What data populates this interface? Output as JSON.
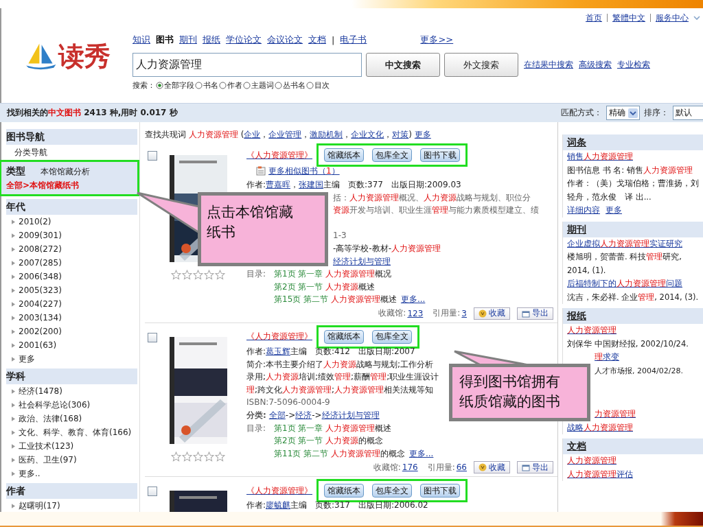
{
  "header": {
    "top_links": [
      "首页",
      "繁體中文",
      "服务中心"
    ],
    "logo": "读秀",
    "nav": [
      {
        "label": "知识",
        "kind": "tab",
        "selected": false
      },
      {
        "label": "图书",
        "kind": "tab",
        "selected": true
      },
      {
        "label": "期刊",
        "kind": "tab",
        "selected": false
      },
      {
        "label": "报纸",
        "kind": "tab",
        "selected": false
      },
      {
        "label": "学位论文",
        "kind": "tab",
        "selected": false
      },
      {
        "label": "会议论文",
        "kind": "tab",
        "selected": false
      },
      {
        "label": "文档",
        "kind": "tab",
        "selected": false
      },
      {
        "label": "|",
        "kind": "separator"
      },
      {
        "label": "电子书",
        "kind": "tab",
        "selected": false
      }
    ],
    "more": "更多>>",
    "search": {
      "value": "人力资源管理"
    },
    "buttons": [
      {
        "label": "中文搜索",
        "primary": true
      },
      {
        "label": "外文搜索",
        "primary": false
      }
    ],
    "links": [
      "在结果中搜索",
      "高级搜索",
      "专业检索"
    ],
    "scope": {
      "label": "搜索：",
      "options": [
        {
          "label": "全部字段",
          "selected": true
        },
        {
          "label": "书名",
          "selected": false
        },
        {
          "label": "作者",
          "selected": false
        },
        {
          "label": "主题词",
          "selected": false
        },
        {
          "label": "丛书名",
          "selected": false
        },
        {
          "label": "目次",
          "selected": false
        }
      ]
    }
  },
  "result_bar": {
    "prefix": "找到相关的",
    "highlight": "中文图书",
    "suffix": " 2413 种,用时 0.017 秒",
    "match_label": "匹配方式：",
    "match_value": "精确",
    "sort_label": "排序：",
    "sort_value": "默认"
  },
  "sidebar": {
    "sections": [
      {
        "title": "图书导航",
        "kind": "list",
        "items": [
          {
            "label": "分类导航",
            "kind": "plain"
          }
        ]
      },
      {
        "title": "类型",
        "kind": "filter",
        "framed": true,
        "note": "本馆馆藏分析",
        "path": "全部>本馆馆藏纸书"
      },
      {
        "title": "年代",
        "kind": "list",
        "items": [
          {
            "label": "2010(2)",
            "kind": "arrow"
          },
          {
            "label": "2009(301)",
            "kind": "arrow"
          },
          {
            "label": "2008(272)",
            "kind": "arrow"
          },
          {
            "label": "2007(285)",
            "kind": "arrow"
          },
          {
            "label": "2006(348)",
            "kind": "arrow"
          },
          {
            "label": "2005(323)",
            "kind": "arrow"
          },
          {
            "label": "2004(227)",
            "kind": "arrow"
          },
          {
            "label": "2003(134)",
            "kind": "arrow"
          },
          {
            "label": "2002(200)",
            "kind": "arrow"
          },
          {
            "label": "2001(63)",
            "kind": "arrow"
          },
          {
            "label": "更多",
            "kind": "arrow"
          }
        ]
      },
      {
        "title": "学科",
        "kind": "list",
        "items": [
          {
            "label": "经济(1478)",
            "kind": "arrow"
          },
          {
            "label": "社会科学总论(306)",
            "kind": "arrow"
          },
          {
            "label": "政治、法律(168)",
            "kind": "arrow"
          },
          {
            "label": "文化、科学、教育、体育(166)",
            "kind": "arrow"
          },
          {
            "label": "工业技术(123)",
            "kind": "arrow"
          },
          {
            "label": "医药、卫生(97)",
            "kind": "arrow"
          },
          {
            "label": "更多..",
            "kind": "arrow"
          }
        ]
      },
      {
        "title": "作者",
        "kind": "list",
        "items": [
          {
            "label": "赵曙明(17)",
            "kind": "arrow"
          }
        ]
      }
    ]
  },
  "main": {
    "cooccur": [
      {
        "t": "查找共现词 "
      },
      {
        "t": "人力资源管理",
        "hit": true
      },
      {
        "t": " ("
      },
      {
        "t": "企业",
        "link": true
      },
      {
        "t": "，"
      },
      {
        "t": "企业管理",
        "link": true
      },
      {
        "t": "，"
      },
      {
        "t": "激励机制",
        "link": true
      },
      {
        "t": "，"
      },
      {
        "t": "企业文化",
        "link": true
      },
      {
        "t": "，"
      },
      {
        "t": "对策",
        "link": true
      },
      {
        "t": ") "
      },
      {
        "t": "更多",
        "link": true
      }
    ],
    "books": [
      {
        "checked": false,
        "stars": 0,
        "title": "《人力资源管理》",
        "framed": true,
        "buttons": [
          "馆藏纸本",
          "包库全文",
          "图书下载"
        ],
        "similar": [
          {
            "t": "更多相似图书（"
          },
          {
            "t": "1",
            "hit": true
          },
          {
            "t": "）"
          }
        ],
        "lines": [
          {
            "kind": "full",
            "segs": [
              {
                "t": "作者:"
              },
              {
                "t": "曹嘉晖",
                "link": true
              },
              {
                "t": "，"
              },
              {
                "t": "张建国",
                "link": true
              },
              {
                "t": "主编　页数:377　出版日期:2009.03"
              }
            ]
          },
          {
            "kind": "partial",
            "segs": [
              {
                "t": "括：",
                "grey": true
              },
              {
                "t": "人力资源管理",
                "hit": true
              },
              {
                "t": "概况、",
                "grey": true
              },
              {
                "t": "人力资源",
                "hit": true
              },
              {
                "t": "战略与规划、职位分",
                "grey": true
              }
            ]
          },
          {
            "kind": "partial",
            "segs": [
              {
                "t": "资源",
                "hit": true
              },
              {
                "t": "开发与培训、职业生涯",
                "grey": true
              },
              {
                "t": "管理",
                "hit": true
              },
              {
                "t": "与能力素质模型建立、绩",
                "grey": true
              }
            ]
          },
          {
            "kind": "gap"
          },
          {
            "kind": "partial",
            "segs": [
              {
                "t": "1-3",
                "grey": true
              }
            ]
          },
          {
            "kind": "partial",
            "segs": [
              {
                "t": "-高等学校-教材-"
              },
              {
                "t": "人力资源管理",
                "hit": true
              }
            ]
          },
          {
            "kind": "partial",
            "segs": [
              {
                "t": "经济计划与管理",
                "link": true
              }
            ]
          }
        ],
        "toc_label": "目录:",
        "toc": [
          {
            "page": "第1页 第一章",
            "segs": [
              {
                "t": "人力资源管理",
                "hit": true
              },
              {
                "t": "概况"
              }
            ]
          },
          {
            "page": "第2页 第一节",
            "segs": [
              {
                "t": "人力资源",
                "hit": true
              },
              {
                "t": "概述"
              }
            ]
          },
          {
            "page": "第15页 第二节",
            "segs": [
              {
                "t": "人力资源管理",
                "hit": true
              },
              {
                "t": "概述"
              }
            ]
          }
        ],
        "toc_more": "更多...",
        "holdings_label": "收藏馆:",
        "holdings": "123",
        "cites_label": "引用量:",
        "cites": "3",
        "actions": [
          "收藏",
          "导出"
        ]
      },
      {
        "checked": false,
        "stars": 0,
        "title": "《人力资源管理》",
        "framed": true,
        "buttons": [
          "馆藏纸本",
          "包库全文"
        ],
        "lines": [
          {
            "kind": "full",
            "segs": [
              {
                "t": "作者:"
              },
              {
                "t": "葛玉辉",
                "link": true
              },
              {
                "t": "主编　页数:412　出版日期:2007"
              }
            ]
          },
          {
            "kind": "full",
            "segs": [
              {
                "t": "简介:本书主要介绍了"
              },
              {
                "t": "人力资源",
                "hit": true
              },
              {
                "t": "战略与规划;工作分析"
              }
            ]
          },
          {
            "kind": "full",
            "segs": [
              {
                "t": "录用;"
              },
              {
                "t": "人力资源",
                "hit": true
              },
              {
                "t": "培训;绩效"
              },
              {
                "t": "管理",
                "hit": true
              },
              {
                "t": ";薪酬"
              },
              {
                "t": "管理",
                "hit": true
              },
              {
                "t": ";职业生涯设计"
              }
            ]
          },
          {
            "kind": "full",
            "segs": [
              {
                "t": "理",
                "hit": true
              },
              {
                "t": ";跨文化"
              },
              {
                "t": "人力资源管理",
                "hit": true
              },
              {
                "t": ";"
              },
              {
                "t": "人力资源管理",
                "hit": true
              },
              {
                "t": "相关法规等知"
              }
            ]
          },
          {
            "kind": "full",
            "segs": [
              {
                "t": "ISBN:7-5096-0004-9",
                "grey": true
              }
            ]
          },
          {
            "kind": "full",
            "segs": [
              {
                "t": "分类:",
                "bold": true
              },
              {
                "t": "全部",
                "link": true
              },
              {
                "t": "->"
              },
              {
                "t": "经济",
                "link": true
              },
              {
                "t": "->"
              },
              {
                "t": "经济计划与管理",
                "link": true
              }
            ]
          }
        ],
        "toc_label": "目录:",
        "toc": [
          {
            "page": "第1页 第一章",
            "segs": [
              {
                "t": "人力资源管理",
                "hit": true
              },
              {
                "t": "概述"
              }
            ]
          },
          {
            "page": "第2页 第一节",
            "segs": [
              {
                "t": "人力资源",
                "hit": true
              },
              {
                "t": "的概念"
              }
            ]
          },
          {
            "page": "第11页 第二节",
            "segs": [
              {
                "t": "人力资源管理",
                "hit": true
              },
              {
                "t": "的概念"
              }
            ]
          }
        ],
        "toc_more": "更多...",
        "holdings_label": "收藏馆:",
        "holdings": "176",
        "cites_label": "引用量:",
        "cites": "66",
        "actions": [
          "收藏",
          "导出"
        ]
      },
      {
        "checked": false,
        "title": "《人力资源管理》",
        "framed": true,
        "buttons": [
          "馆藏纸本",
          "包库全文",
          "图书下载"
        ],
        "lines": [
          {
            "kind": "full",
            "segs": [
              {
                "t": "作者:"
              },
              {
                "t": "廖毓麒",
                "link": true
              },
              {
                "t": "主编　页数:317　出版日期:2006.02"
              }
            ]
          }
        ]
      }
    ]
  },
  "right": {
    "sections": [
      {
        "title": "词条",
        "items": [
          {
            "kind": "link",
            "segs": [
              {
                "t": "销售"
              },
              {
                "t": "人力资源管理",
                "hit": true
              }
            ]
          },
          {
            "kind": "text",
            "segs": [
              {
                "t": "图书信息 书 名: 销售"
              },
              {
                "t": "人力资源管理",
                "hit": true
              },
              {
                "t": " 作者：（美）戈瑞伯格；曹淮扬，刘轻舟，范永俊　译 出..."
              }
            ]
          },
          {
            "kind": "links",
            "links": [
              "详细内容",
              "更多"
            ]
          }
        ]
      },
      {
        "title": "期刊",
        "items": [
          {
            "kind": "link",
            "segs": [
              {
                "t": "企业虚拟"
              },
              {
                "t": "人力资源管理",
                "hit": true
              },
              {
                "t": "实证研究"
              }
            ]
          },
          {
            "kind": "text",
            "segs": [
              {
                "t": "楼旭明，贺蕾蕾. 科技"
              },
              {
                "t": "管理",
                "hit": true
              },
              {
                "t": "研究, 2014, (1)."
              }
            ]
          },
          {
            "kind": "link",
            "segs": [
              {
                "t": "后福特制下的"
              },
              {
                "t": "人力资源管理",
                "hit": true
              },
              {
                "t": "问题"
              }
            ]
          },
          {
            "kind": "text",
            "segs": [
              {
                "t": "沈吉，朱必祥. 企业"
              },
              {
                "t": "管理",
                "hit": true
              },
              {
                "t": ", 2014, (3)."
              }
            ]
          }
        ]
      },
      {
        "title": "报纸",
        "items": [
          {
            "kind": "link",
            "segs": [
              {
                "t": "人力资源管理",
                "hit": true
              }
            ]
          },
          {
            "kind": "text",
            "segs": [
              {
                "t": "刘保华 中国财经报, 2002/10/24."
              }
            ]
          },
          {
            "kind": "partial-link",
            "segs": [
              {
                "t": "理",
                "hit": true
              },
              {
                "t": "求变"
              }
            ]
          },
          {
            "kind": "partial-text",
            "segs": [
              {
                "t": "人才市场报, 2004/02/28."
              }
            ]
          },
          {
            "kind": "gap"
          },
          {
            "kind": "partial-link",
            "segs": [
              {
                "t": "力资源管理",
                "hit": true
              }
            ]
          },
          {
            "kind": "link",
            "segs": [
              {
                "t": "战略"
              },
              {
                "t": "人力资源管理",
                "hit": true
              }
            ]
          }
        ]
      },
      {
        "title": "文档",
        "items": [
          {
            "kind": "link",
            "segs": [
              {
                "t": "人力资源管理",
                "hit": true
              }
            ]
          },
          {
            "kind": "link",
            "segs": [
              {
                "t": "人力资源管理",
                "hit": true
              },
              {
                "t": "评估"
              }
            ]
          }
        ]
      }
    ]
  },
  "callouts": [
    {
      "lines": [
        "点击本馆馆藏",
        "纸书"
      ]
    },
    {
      "lines": [
        "得到图书馆拥有",
        "纸质馆藏的图书"
      ]
    }
  ]
}
